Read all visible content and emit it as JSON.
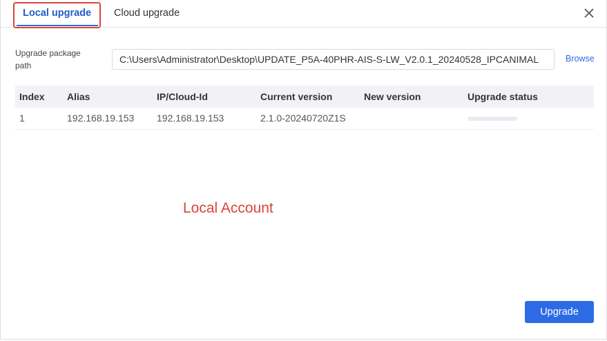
{
  "tabs": [
    {
      "label": "Local upgrade",
      "active": true
    },
    {
      "label": "Cloud upgrade",
      "active": false
    }
  ],
  "icons": {
    "close": "close-icon"
  },
  "path": {
    "label": "Upgrade package path",
    "value": "C:\\Users\\Administrator\\Desktop\\UPDATE_P5A-40PHR-AIS-S-LW_V2.0.1_20240528_IPCANIMAL",
    "browse_label": "Browse"
  },
  "table": {
    "headers": [
      "Index",
      "Alias",
      "IP/Cloud-Id",
      "Current version",
      "New version",
      "Upgrade status"
    ],
    "rows": [
      {
        "index": "1",
        "alias": "192.168.19.153",
        "ip": "192.168.19.153",
        "current_version": "2.1.0-20240720Z1S",
        "new_version": "",
        "upgrade_progress": 0
      }
    ]
  },
  "annotation": {
    "text": "Local Account",
    "color": "#d9443a"
  },
  "footer": {
    "upgrade_label": "Upgrade"
  },
  "colors": {
    "accent": "#2d6be6",
    "highlight": "#d9443a",
    "header_bg": "#f1f2f5"
  }
}
